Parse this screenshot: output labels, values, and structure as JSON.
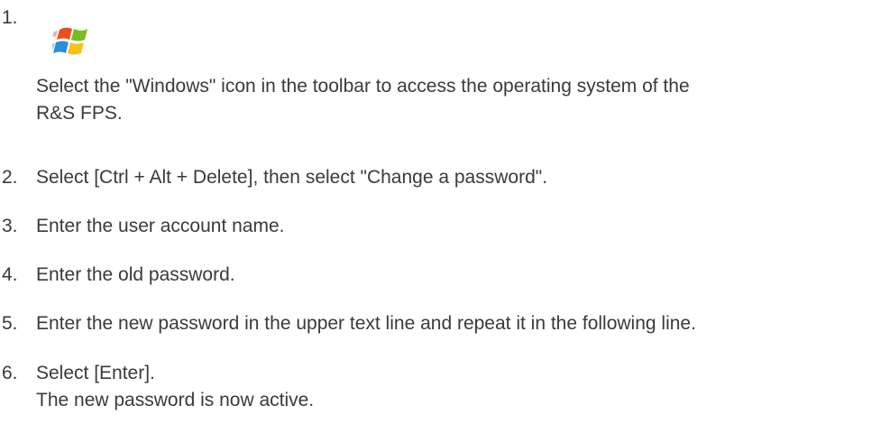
{
  "steps": [
    {
      "number": "1.",
      "icon": "windows-logo-icon",
      "lines": [
        "Select the \"Windows\" icon in the toolbar to access the operating system of the",
        "R&S FPS."
      ]
    },
    {
      "number": "2.",
      "lines": [
        "Select [Ctrl  + Alt + Delete], then select \"Change a password\"."
      ]
    },
    {
      "number": "3.",
      "lines": [
        "Enter the user account name."
      ]
    },
    {
      "number": "4.",
      "lines": [
        "Enter the old password."
      ]
    },
    {
      "number": "5.",
      "lines": [
        "Enter the new password in the upper text line and repeat it in the following line."
      ]
    },
    {
      "number": "6.",
      "lines": [
        "Select [Enter].",
        "The new password is now active."
      ]
    }
  ],
  "colors": {
    "text": "#3a3a3a",
    "logo_red": "#e8501e",
    "logo_green": "#7cbb22",
    "logo_blue": "#2a8fd6",
    "logo_yellow": "#f6c11a"
  }
}
